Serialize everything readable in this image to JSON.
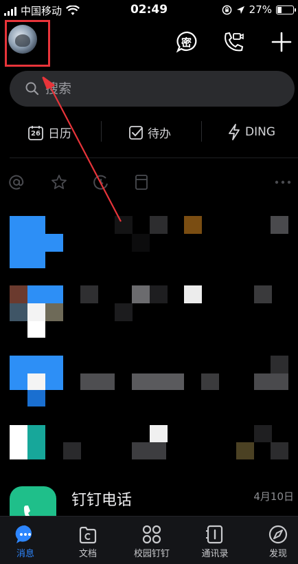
{
  "status_bar": {
    "carrier": "中国移动",
    "time": "02:49",
    "battery": "27%",
    "battery_level": 0.27
  },
  "header": {
    "avatar_icon": "avatar-icon",
    "secret_chat_icon": "secret-chat-icon",
    "secret_chat_glyph": "密",
    "video_call_icon": "video-call-icon",
    "add_icon": "plus-icon"
  },
  "search": {
    "placeholder": "搜索"
  },
  "quick_actions": [
    {
      "label": "日历",
      "icon": "calendar-icon",
      "day": "26"
    },
    {
      "label": "待办",
      "icon": "todo-check-icon"
    },
    {
      "label": "DING",
      "icon": "lightning-icon"
    }
  ],
  "filters": [
    "at-icon",
    "star-icon",
    "at-clock-icon",
    "file-icon",
    "more-icon"
  ],
  "chats": [
    {
      "name": "钉钉电话",
      "date": "4月10日",
      "icon": "phone-icon"
    }
  ],
  "tabs": [
    {
      "label": "消息",
      "icon": "message-icon",
      "active": true
    },
    {
      "label": "文档",
      "icon": "document-icon",
      "active": false
    },
    {
      "label": "校园钉钉",
      "icon": "grid-apps-icon",
      "active": false
    },
    {
      "label": "通讯录",
      "icon": "contacts-icon",
      "active": false
    },
    {
      "label": "发现",
      "icon": "compass-icon",
      "active": false
    }
  ],
  "colors": {
    "accent": "#2d86ff",
    "annotation": "#e8343a",
    "background": "#000000",
    "dingtalk_green": "#1fbf8a"
  }
}
